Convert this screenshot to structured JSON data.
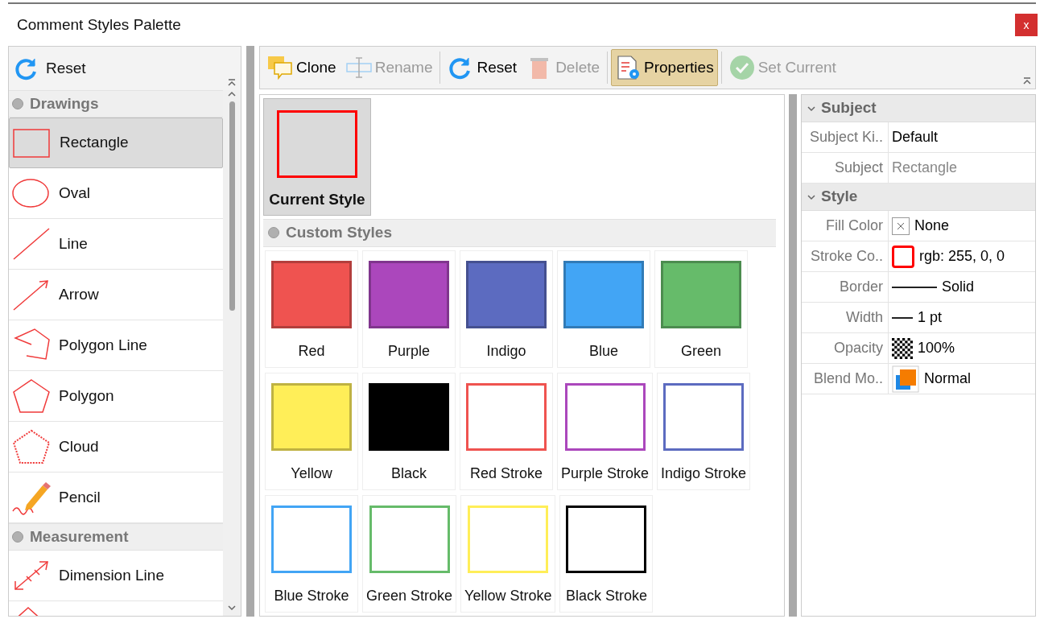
{
  "window": {
    "title": "Comment Styles Palette",
    "close": "x"
  },
  "sidebar": {
    "reset": "Reset",
    "groups": [
      {
        "title": "Drawings",
        "items": [
          {
            "label": "Rectangle",
            "kind": "rectangle",
            "selected": true
          },
          {
            "label": "Oval",
            "kind": "oval",
            "selected": false
          },
          {
            "label": "Line",
            "kind": "line",
            "selected": false
          },
          {
            "label": "Arrow",
            "kind": "arrow",
            "selected": false
          },
          {
            "label": "Polygon Line",
            "kind": "polyline",
            "selected": false
          },
          {
            "label": "Polygon",
            "kind": "polygon",
            "selected": false
          },
          {
            "label": "Cloud",
            "kind": "cloud",
            "selected": false
          },
          {
            "label": "Pencil",
            "kind": "pencil",
            "selected": false
          }
        ]
      },
      {
        "title": "Measurement",
        "items": [
          {
            "label": "Dimension Line",
            "kind": "dimension",
            "selected": false
          },
          {
            "kind": "area",
            "selected": false
          }
        ]
      }
    ]
  },
  "toolbar": [
    {
      "label": "Clone",
      "kind": "clone",
      "disabled": false,
      "selected": false
    },
    {
      "label": "Rename",
      "kind": "rename",
      "disabled": true,
      "selected": false
    },
    {
      "label": "Reset",
      "kind": "reset",
      "disabled": false,
      "selected": false
    },
    {
      "label": "Delete",
      "kind": "delete",
      "disabled": true,
      "selected": false
    },
    {
      "label": "Properties",
      "kind": "properties",
      "disabled": false,
      "selected": true
    },
    {
      "label": "Set Current",
      "kind": "setcurrent",
      "disabled": true,
      "selected": false
    }
  ],
  "current_style": {
    "label": "Current Style",
    "color": "#ff0000"
  },
  "custom_styles": {
    "title": "Custom Styles",
    "items": [
      {
        "label": "Red",
        "kind": "fill",
        "color": "#ef5350"
      },
      {
        "label": "Purple",
        "kind": "fill",
        "color": "#ab47bc"
      },
      {
        "label": "Indigo",
        "kind": "fill",
        "color": "#5c6bc0"
      },
      {
        "label": "Blue",
        "kind": "fill",
        "color": "#42a5f5"
      },
      {
        "label": "Green",
        "kind": "fill",
        "color": "#66bb6a"
      },
      {
        "label": "Yellow",
        "kind": "fill",
        "color": "#ffee58"
      },
      {
        "label": "Black",
        "kind": "fill",
        "color": "#000000"
      },
      {
        "label": "Red Stroke",
        "kind": "stroke",
        "color": "#ef5350"
      },
      {
        "label": "Purple Stroke",
        "kind": "stroke",
        "color": "#ab47bc"
      },
      {
        "label": "Indigo Stroke",
        "kind": "stroke",
        "color": "#5c6bc0"
      },
      {
        "label": "Blue Stroke",
        "kind": "stroke",
        "color": "#42a5f5"
      },
      {
        "label": "Green Stroke",
        "kind": "stroke",
        "color": "#66bb6a"
      },
      {
        "label": "Yellow Stroke",
        "kind": "stroke",
        "color": "#ffee58"
      },
      {
        "label": "Black Stroke",
        "kind": "stroke",
        "color": "#000000"
      }
    ]
  },
  "properties": [
    {
      "title": "Subject",
      "expanded": true,
      "rows": [
        {
          "label": "Subject Ki..",
          "value": "Default",
          "kind": "text"
        },
        {
          "label": "Subject",
          "value": "Rectangle",
          "kind": "muted"
        }
      ]
    },
    {
      "title": "Style",
      "expanded": true,
      "rows": [
        {
          "label": "Fill Color",
          "value": "None",
          "kind": "nofill"
        },
        {
          "label": "Stroke Co..",
          "value": "rgb: 255, 0, 0",
          "kind": "stroke"
        },
        {
          "label": "Border",
          "value": "Solid",
          "kind": "border"
        },
        {
          "label": "Width",
          "value": "1 pt",
          "kind": "width"
        },
        {
          "label": "Opacity",
          "value": "100%",
          "kind": "opacity"
        },
        {
          "label": "Blend Mo..",
          "value": "Normal",
          "kind": "blend"
        }
      ]
    }
  ]
}
